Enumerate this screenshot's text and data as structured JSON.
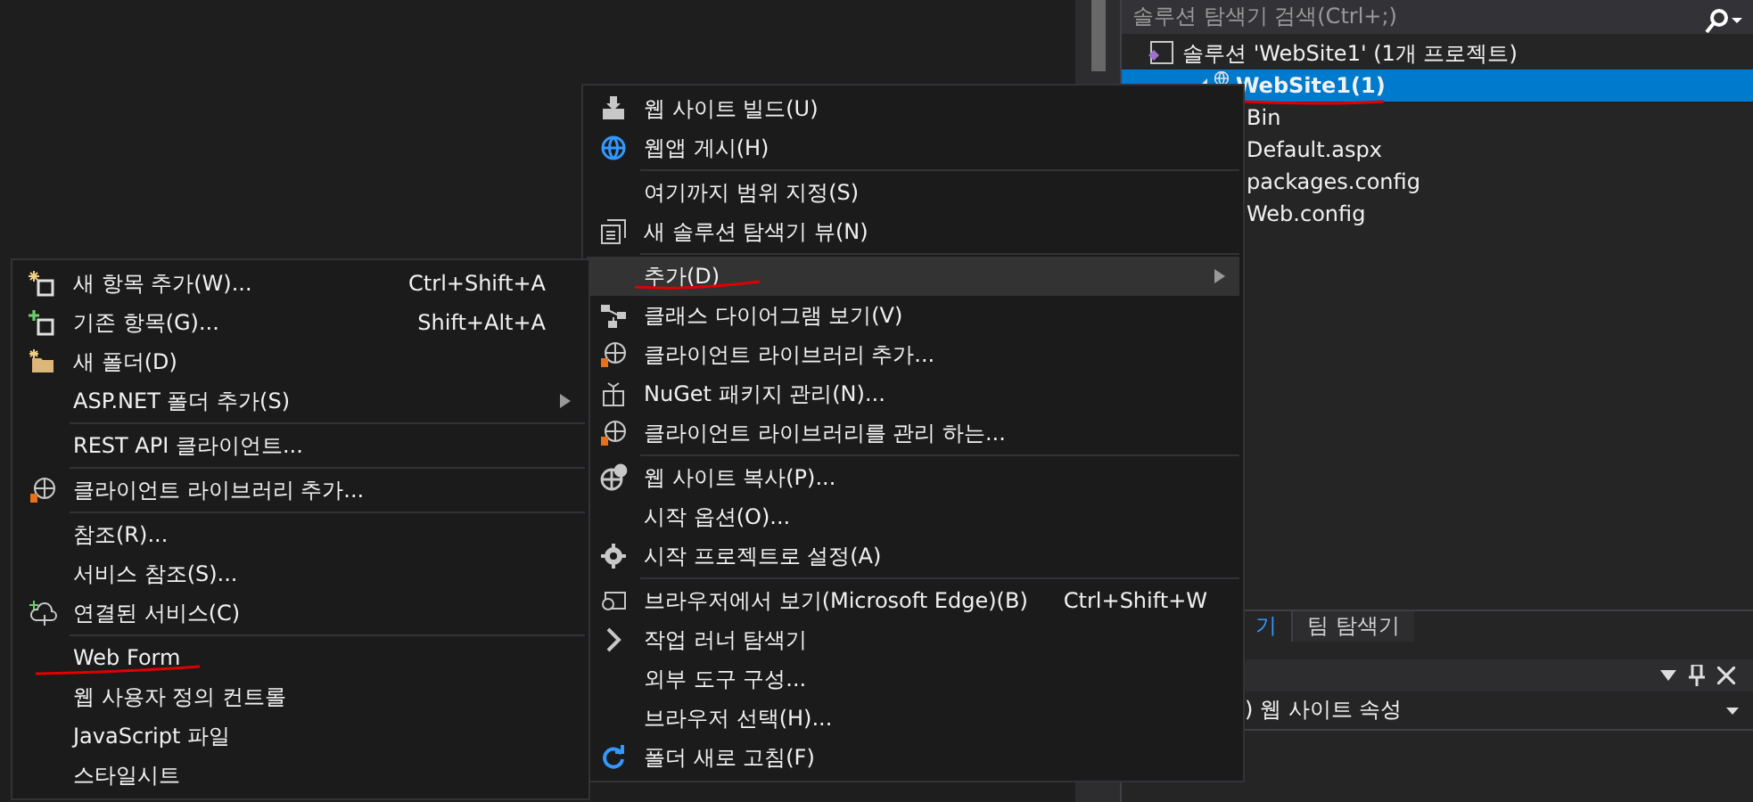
{
  "solution_explorer": {
    "search": {
      "placeholder": "솔루션 탐색기 검색(Ctrl+;)"
    },
    "tree": [
      {
        "label": "솔루션 'WebSite1' (1개 프로젝트)",
        "selected": false,
        "children": [
          {
            "label": "WebSite1(1)",
            "selected": true,
            "children": [
              {
                "label": "Bin",
                "selected": false
              },
              {
                "label": "Default.aspx",
                "selected": false
              },
              {
                "label": "packages.config",
                "selected": false
              },
              {
                "label": "Web.config",
                "selected": false
              }
            ]
          }
        ]
      }
    ],
    "tabs": [
      {
        "label": "기",
        "selected": true
      },
      {
        "label": "팀 탐색기",
        "selected": false
      }
    ]
  },
  "properties": {
    "title": ") 웹 사이트 속성"
  },
  "context_menu": [
    {
      "kind": "item",
      "label": "웹 사이트 빌드(U)",
      "highlighted": false
    },
    {
      "kind": "item",
      "label": "웹앱 게시(H)",
      "highlighted": false
    },
    {
      "kind": "separator"
    },
    {
      "kind": "item",
      "label": "여기까지 범위 지정(S)",
      "highlighted": false
    },
    {
      "kind": "item",
      "label": "새 솔루션 탐색기 뷰(N)",
      "highlighted": false
    },
    {
      "kind": "separator"
    },
    {
      "kind": "item",
      "label": "추가(D)",
      "submenu": true,
      "highlighted": true
    },
    {
      "kind": "item",
      "label": "클래스 다이어그램 보기(V)",
      "highlighted": false
    },
    {
      "kind": "item",
      "label": "클라이언트 라이브러리 추가...",
      "highlighted": false
    },
    {
      "kind": "item",
      "label": "NuGet 패키지 관리(N)...",
      "highlighted": false
    },
    {
      "kind": "item",
      "label": "클라이언트 라이브러리를 관리 하는...",
      "highlighted": false
    },
    {
      "kind": "separator"
    },
    {
      "kind": "item",
      "label": "웹 사이트 복사(P)...",
      "highlighted": false
    },
    {
      "kind": "item",
      "label": "시작 옵션(O)...",
      "highlighted": false
    },
    {
      "kind": "item",
      "label": "시작 프로젝트로 설정(A)",
      "highlighted": false
    },
    {
      "kind": "separator"
    },
    {
      "kind": "item",
      "label": "브라우저에서 보기(Microsoft Edge)(B)",
      "shortcut": "Ctrl+Shift+W",
      "highlighted": false
    },
    {
      "kind": "item",
      "label": "작업 러너 탐색기",
      "highlighted": false
    },
    {
      "kind": "item",
      "label": "외부 도구 구성...",
      "highlighted": false
    },
    {
      "kind": "item",
      "label": "브라우저 선택(H)...",
      "highlighted": false
    },
    {
      "kind": "item",
      "label": "폴더 새로 고침(F)",
      "highlighted": false
    }
  ],
  "add_submenu": [
    {
      "kind": "item",
      "label": "새 항목 추가(W)...",
      "shortcut": "Ctrl+Shift+A",
      "highlighted": false
    },
    {
      "kind": "item",
      "label": "기존 항목(G)...",
      "shortcut": "Shift+Alt+A",
      "highlighted": false
    },
    {
      "kind": "item",
      "label": "새 폴더(D)",
      "highlighted": false
    },
    {
      "kind": "item",
      "label": "ASP.NET 폴더 추가(S)",
      "submenu": true,
      "highlighted": false
    },
    {
      "kind": "separator"
    },
    {
      "kind": "item",
      "label": "REST API 클라이언트...",
      "highlighted": false
    },
    {
      "kind": "separator"
    },
    {
      "kind": "item",
      "label": "클라이언트 라이브러리 추가...",
      "highlighted": false
    },
    {
      "kind": "separator"
    },
    {
      "kind": "item",
      "label": "참조(R)...",
      "highlighted": false
    },
    {
      "kind": "item",
      "label": "서비스 참조(S)...",
      "highlighted": false
    },
    {
      "kind": "item",
      "label": "연결된 서비스(C)",
      "highlighted": false
    },
    {
      "kind": "separator"
    },
    {
      "kind": "item",
      "label": "Web Form",
      "highlighted": false
    },
    {
      "kind": "item",
      "label": "웹 사용자 정의 컨트롤",
      "highlighted": false
    },
    {
      "kind": "item",
      "label": "JavaScript 파일",
      "highlighted": false
    },
    {
      "kind": "item",
      "label": "스타일시트",
      "highlighted": false
    }
  ]
}
